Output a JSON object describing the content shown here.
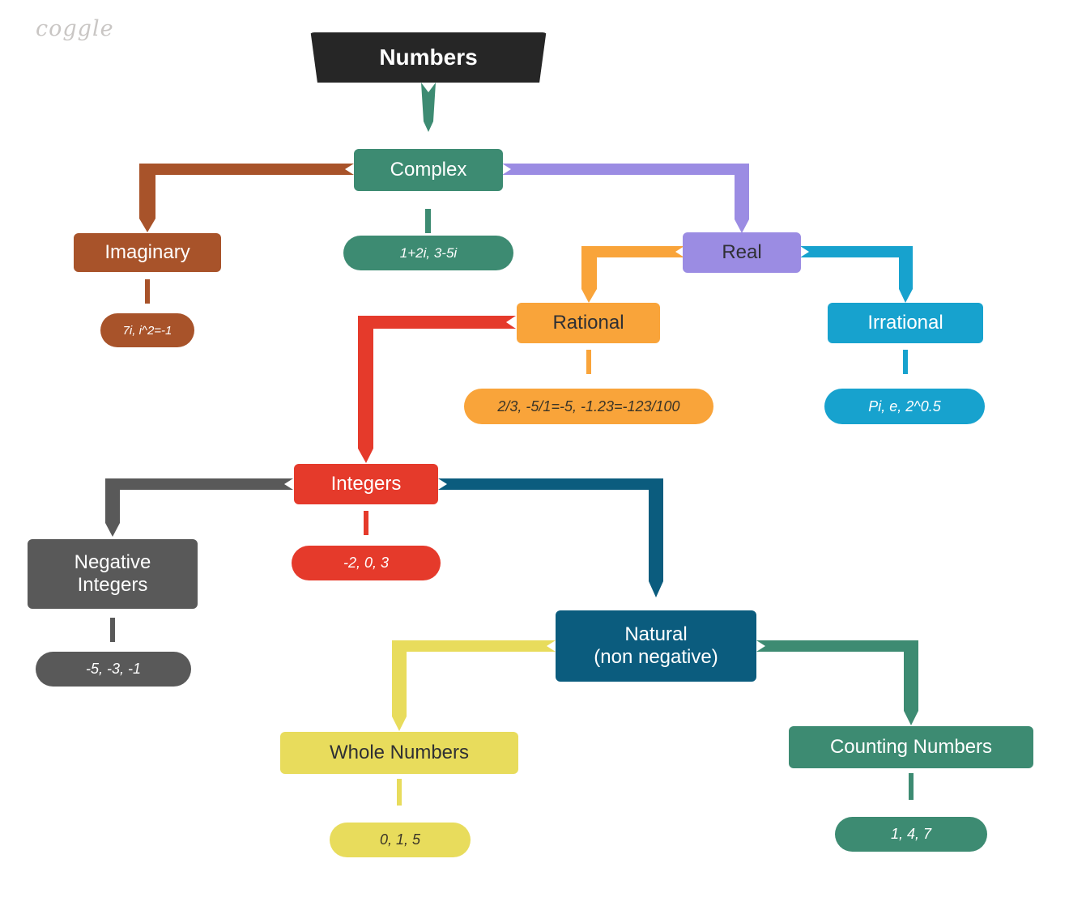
{
  "app": {
    "logo": "coggle",
    "background": "#ffffff"
  },
  "diagram": {
    "type": "mind-map",
    "title": "Numbers",
    "root": {
      "label": "Numbers",
      "color": "#262626",
      "text_color": "#ffffff"
    },
    "nodes": [
      {
        "id": "complex",
        "label": "Complex",
        "color": "#3d8b72",
        "text_color": "#ffffff",
        "parent": "Numbers",
        "example": "1+2i, 3-5i"
      },
      {
        "id": "imaginary",
        "label": "Imaginary",
        "color": "#a8532a",
        "text_color": "#ffffff",
        "parent": "Complex",
        "example": "7i, i^2=-1"
      },
      {
        "id": "real",
        "label": "Real",
        "color": "#9b8ce3",
        "text_color": "#2f3034",
        "parent": "Complex",
        "example": ""
      },
      {
        "id": "rational",
        "label": "Rational",
        "color": "#f9a43a",
        "text_color": "#2f3034",
        "parent": "Real",
        "example": "2/3, -5/1=-5, -1.23=-123/100"
      },
      {
        "id": "irrational",
        "label": "Irrational",
        "color": "#17a2ce",
        "text_color": "#ffffff",
        "parent": "Real",
        "example": "Pi, e, 2^0.5"
      },
      {
        "id": "integers",
        "label": "Integers",
        "color": "#e53a2b",
        "text_color": "#ffffff",
        "parent": "Rational",
        "example": "-2, 0, 3"
      },
      {
        "id": "negative-integers",
        "label": "Negative\nIntegers",
        "color": "#595959",
        "text_color": "#ffffff",
        "parent": "Integers",
        "example": "-5, -3, -1"
      },
      {
        "id": "natural",
        "label": "Natural\n(non negative)",
        "color": "#0b5c7e",
        "text_color": "#ffffff",
        "parent": "Integers",
        "example": ""
      },
      {
        "id": "whole-numbers",
        "label": "Whole Numbers",
        "color": "#e8dc5c",
        "text_color": "#3a3427",
        "parent": "Natural (non negative)",
        "example": "0, 1, 5"
      },
      {
        "id": "counting-numbers",
        "label": "Counting Numbers",
        "color": "#3d8b72",
        "text_color": "#ffffff",
        "parent": "Natural (non negative)",
        "example": "1, 4, 7"
      }
    ],
    "leaves": [
      {
        "id": "leaf-complex",
        "text": "1+2i, 3-5i",
        "color": "#3d8b72",
        "text_color": "#ffffff"
      },
      {
        "id": "leaf-imaginary",
        "text": "7i, i^2=-1",
        "color": "#a8532a",
        "text_color": "#ffffff"
      },
      {
        "id": "leaf-rational",
        "text": "2/3, -5/1=-5, -1.23=-123/100",
        "color": "#f9a43a",
        "text_color": "#3a3427"
      },
      {
        "id": "leaf-irrational",
        "text": "Pi, e, 2^0.5",
        "color": "#17a2ce",
        "text_color": "#ffffff"
      },
      {
        "id": "leaf-integers",
        "text": "-2, 0, 3",
        "color": "#e53a2b",
        "text_color": "#ffffff"
      },
      {
        "id": "leaf-negative",
        "text": "-5, -3, -1",
        "color": "#595959",
        "text_color": "#ffffff"
      },
      {
        "id": "leaf-whole",
        "text": "0, 1, 5",
        "color": "#e8dc5c",
        "text_color": "#3a3427"
      },
      {
        "id": "leaf-counting",
        "text": "1, 4, 7",
        "color": "#3d8b72",
        "text_color": "#ffffff"
      }
    ],
    "edges": [
      {
        "from": "Numbers",
        "to": "Complex",
        "color": "#3d8b72"
      },
      {
        "from": "Complex",
        "to": "Imaginary",
        "color": "#a8532a"
      },
      {
        "from": "Complex",
        "to": "Real",
        "color": "#9b8ce3"
      },
      {
        "from": "Real",
        "to": "Rational",
        "color": "#f9a43a"
      },
      {
        "from": "Real",
        "to": "Irrational",
        "color": "#17a2ce"
      },
      {
        "from": "Rational",
        "to": "Integers",
        "color": "#e53a2b"
      },
      {
        "from": "Integers",
        "to": "Negative Integers",
        "color": "#595959"
      },
      {
        "from": "Integers",
        "to": "Natural",
        "color": "#0b5c7e"
      },
      {
        "from": "Natural",
        "to": "Whole Numbers",
        "color": "#e8dc5c"
      },
      {
        "from": "Natural",
        "to": "Counting Numbers",
        "color": "#3d8b72"
      }
    ]
  }
}
